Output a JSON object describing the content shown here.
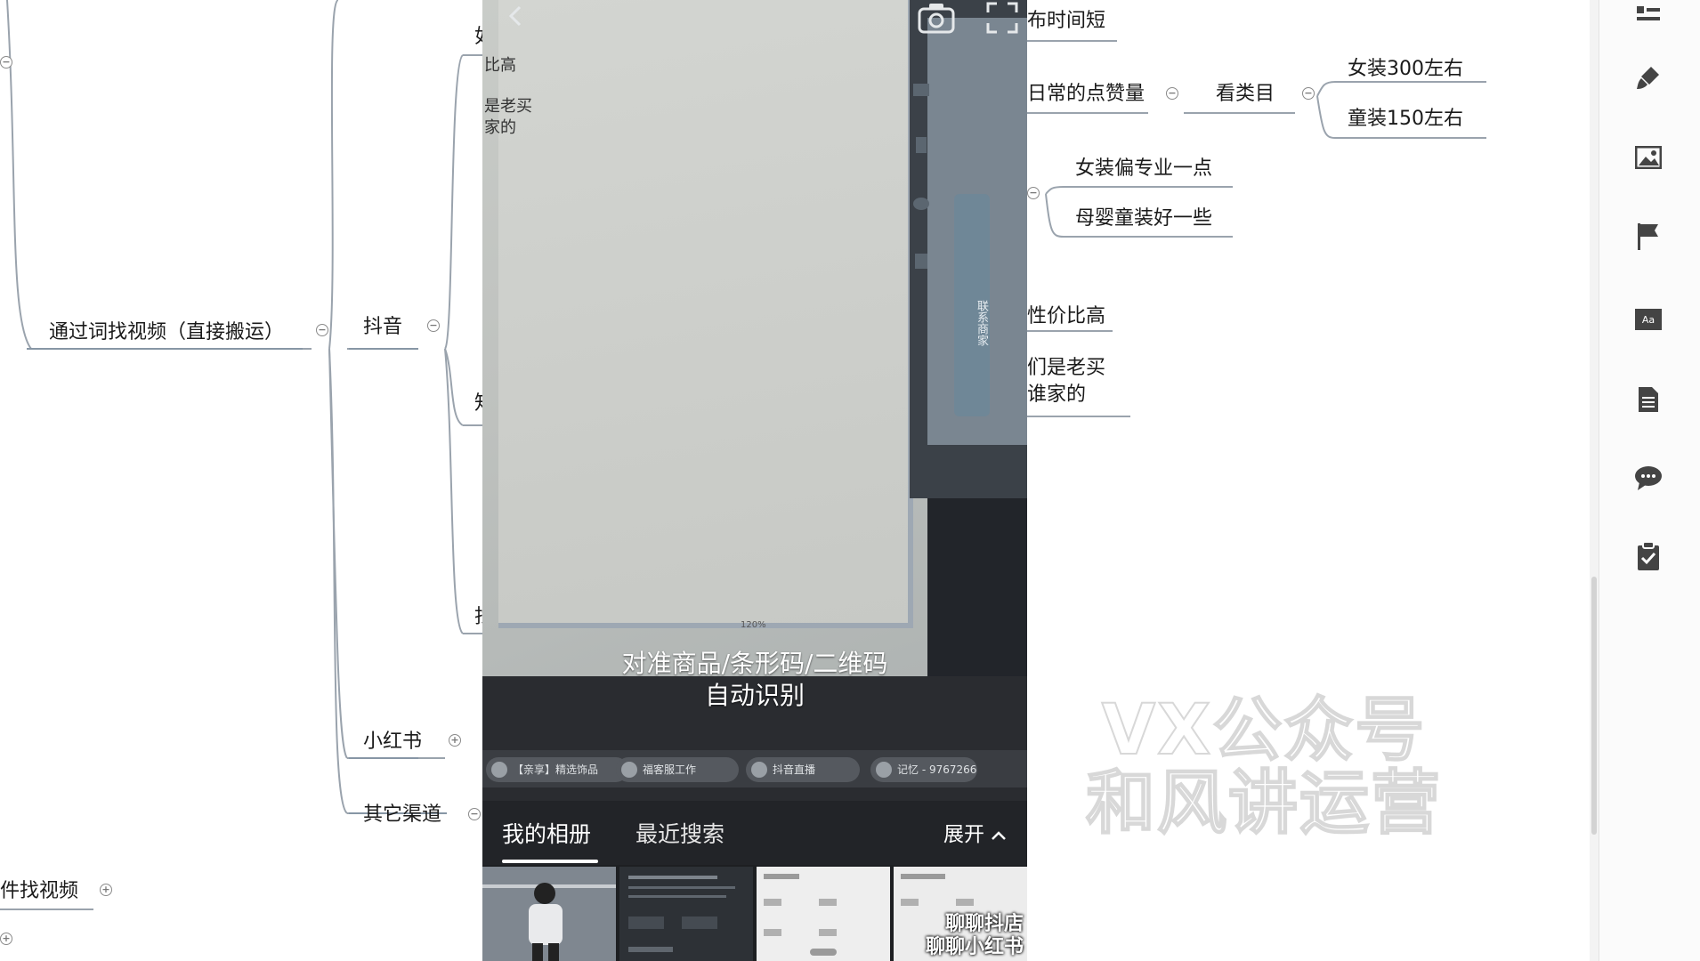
{
  "mindmap": {
    "root_partial": "件找视频",
    "branch_video": "通过词找视频（直接搬运）",
    "channel_douyin": "抖音",
    "channel_xhs": "小红书",
    "channel_other": "其它渠道",
    "partial_1": "如",
    "partial_1_sub_a": "比高",
    "partial_1_sub_b": "是老买",
    "partial_1_sub_c": "家的",
    "partial_2": "知",
    "partial_3": "找",
    "right_nodes": {
      "time_short": "布时间短",
      "daily_likes": "日常的点赞量",
      "by_category": "看类目",
      "women_300": "女装300左右",
      "kids_150": "童装150左右",
      "women_pro": "女装偏专业一点",
      "baby_better": "母婴童装好一些",
      "value_high": "性价比高",
      "old_buyer_1": "们是老买",
      "old_buyer_2": "谁家的"
    }
  },
  "phone": {
    "hint_line1": "对准商品/条形码/二维码",
    "hint_line2": "自动识别",
    "side_panel_text": "联系商家",
    "zoom_readout": "120%",
    "chips": [
      "【亲享】精选饰品",
      "福客服工作",
      "抖音直播",
      "记忆 - 9767266"
    ],
    "tab_album": "我的相册",
    "tab_recent": "最近搜索",
    "expand_label": "展开",
    "thumb_caption_1": "聊聊抖店",
    "thumb_caption_2": "聊聊小红书"
  },
  "watermark": {
    "line1": "VX公众号",
    "line2": "和风讲运营"
  },
  "toolbar": {
    "icons": [
      "outline-icon",
      "brush-icon",
      "image-icon",
      "flag-icon",
      "text-style-icon",
      "document-icon",
      "comment-icon",
      "clipboard-check-icon"
    ]
  }
}
